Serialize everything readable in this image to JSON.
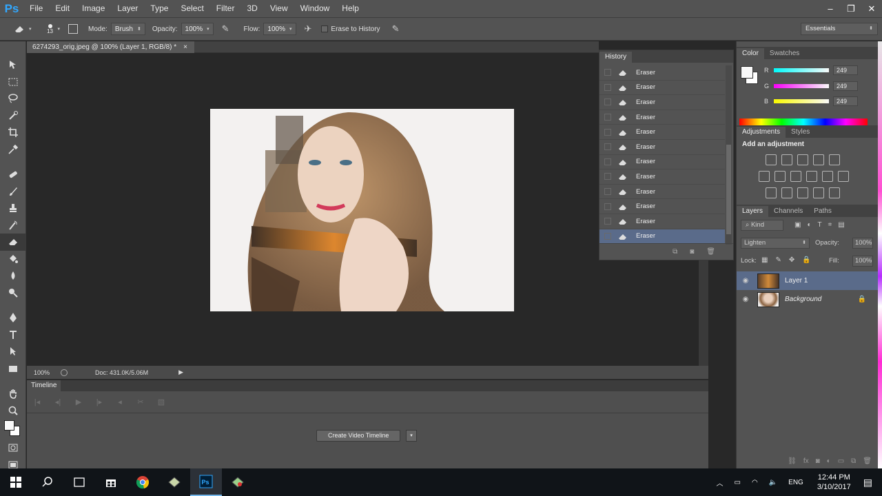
{
  "app": {
    "logo": "Ps"
  },
  "menu": [
    "File",
    "Edit",
    "Image",
    "Layer",
    "Type",
    "Select",
    "Filter",
    "3D",
    "View",
    "Window",
    "Help"
  ],
  "window_controls": [
    "–",
    "❐",
    "✕"
  ],
  "options": {
    "brush_size": "13",
    "mode_label": "Mode:",
    "mode_value": "Brush",
    "opacity_label": "Opacity:",
    "opacity_value": "100%",
    "flow_label": "Flow:",
    "flow_value": "100%",
    "erase_history_label": "Erase to History",
    "workspace": "Essentials"
  },
  "document": {
    "tab_title": "6274293_orig.jpeg @ 100% (Layer 1, RGB/8) *",
    "tab_close": "×",
    "zoom": "100%",
    "doc_info": "Doc: 431.0K/5.06M"
  },
  "timeline": {
    "title": "Timeline",
    "create_button": "Create Video Timeline",
    "caret": "▾"
  },
  "history": {
    "title": "History",
    "items": [
      "Eraser",
      "Eraser",
      "Eraser",
      "Eraser",
      "Eraser",
      "Eraser",
      "Eraser",
      "Eraser",
      "Eraser",
      "Eraser",
      "Eraser",
      "Eraser"
    ],
    "selected_index": 11
  },
  "color": {
    "tabs": [
      "Color",
      "Swatches"
    ],
    "r_label": "R",
    "r_value": "249",
    "g_label": "G",
    "g_value": "249",
    "b_label": "B",
    "b_value": "249",
    "foreground": "#f9f9f9"
  },
  "adjustments": {
    "tabs": [
      "Adjustments",
      "Styles"
    ],
    "heading": "Add an adjustment"
  },
  "layers": {
    "tabs": [
      "Layers",
      "Channels",
      "Paths"
    ],
    "kind_filter": "Kind",
    "blend_mode": "Lighten",
    "opacity_label": "Opacity:",
    "opacity_value": "100%",
    "lock_label": "Lock:",
    "fill_label": "Fill:",
    "fill_value": "100%",
    "items": [
      {
        "name": "Layer 1",
        "selected": true
      },
      {
        "name": "Background",
        "selected": false
      }
    ]
  },
  "taskbar": {
    "time": "12:44 PM",
    "date": "3/10/2017",
    "language": "ENG"
  },
  "colors": {
    "ps_blue": "#31a8ff",
    "selection": "#5a6b8a",
    "panel_bg": "#535353"
  }
}
